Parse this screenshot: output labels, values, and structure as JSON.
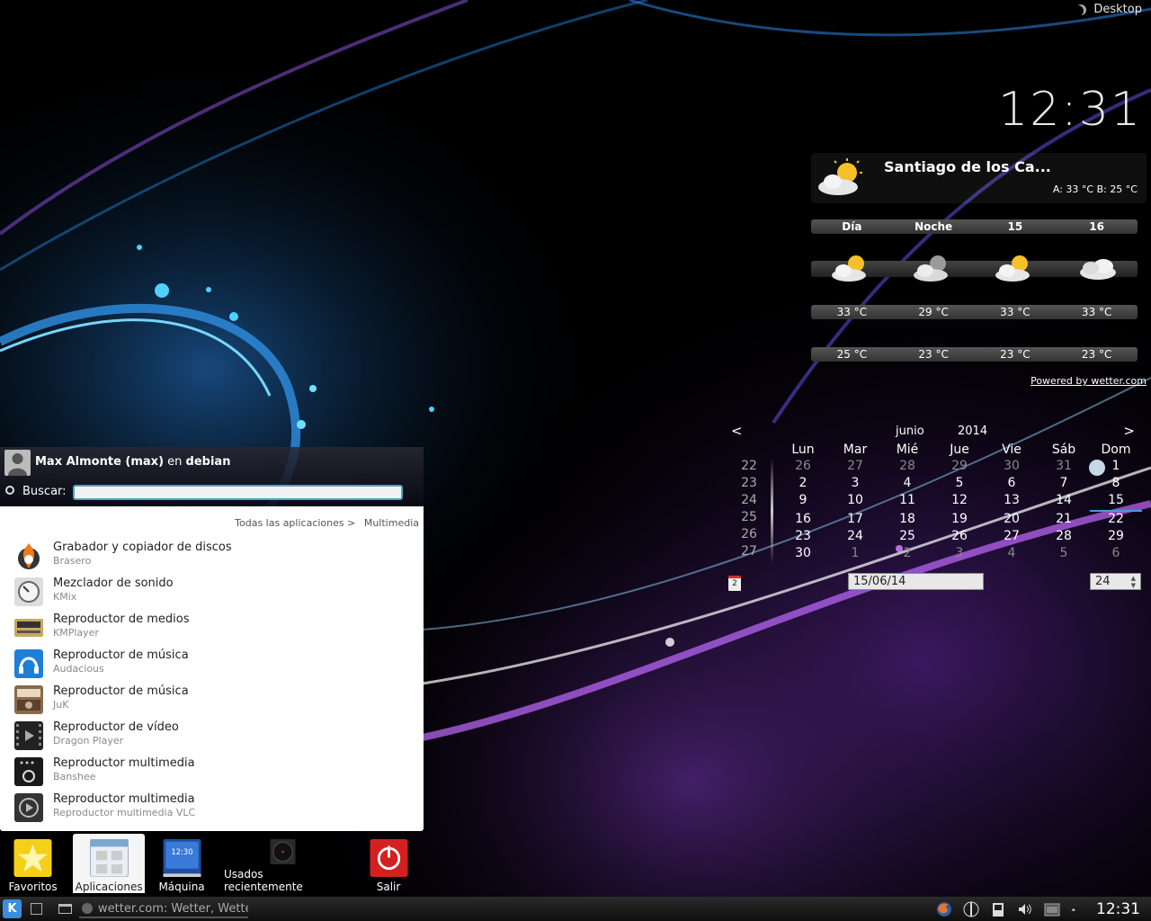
{
  "desktop": {
    "toolbox_label": "Desktop"
  },
  "clock_widget": {
    "time": "12:31"
  },
  "weather": {
    "city": "Santiago de los Ca...",
    "hilo": "A: 33 °C B: 25 °C",
    "days": [
      "Día",
      "Noche",
      "15",
      "16"
    ],
    "icons": [
      "sun-cloud-icon",
      "moon-cloud-icon",
      "sun-cloud-icon",
      "cloud-icon"
    ],
    "highs": [
      "33 °C",
      "29 °C",
      "33 °C",
      "33 °C"
    ],
    "lows": [
      "25 °C",
      "23 °C",
      "23 °C",
      "23 °C"
    ],
    "powered": "Powered by wetter.com"
  },
  "calendar": {
    "prev": "<",
    "next": ">",
    "month": "junio",
    "year": "2014",
    "weekdays": [
      "Lun",
      "Mar",
      "Mié",
      "Jue",
      "Vie",
      "Sáb",
      "Dom"
    ],
    "weeknums": [
      "22",
      "23",
      "24",
      "25",
      "26",
      "27"
    ],
    "days": [
      [
        "26",
        "27",
        "28",
        "29",
        "30",
        "31",
        "1"
      ],
      [
        "2",
        "3",
        "4",
        "5",
        "6",
        "7",
        "8"
      ],
      [
        "9",
        "10",
        "11",
        "12",
        "13",
        "14",
        "15"
      ],
      [
        "16",
        "17",
        "18",
        "19",
        "20",
        "21",
        "22"
      ],
      [
        "23",
        "24",
        "25",
        "26",
        "27",
        "28",
        "29"
      ],
      [
        "30",
        "1",
        "2",
        "3",
        "4",
        "5",
        "6"
      ]
    ],
    "date_value": "15/06/14",
    "week_value": "24",
    "icon_day": "2"
  },
  "kickoff": {
    "user_name": "Max Almonte (max)",
    "user_on": "en",
    "host": "debian",
    "search_label": "Buscar:",
    "search_value": "",
    "breadcrumb": [
      "Todas las aplicaciones >",
      "Multimedia"
    ],
    "apps": [
      {
        "name": "Grabador y copiador de discos",
        "generic": "Brasero",
        "icon": "brasero-icon"
      },
      {
        "name": "Mezclador de sonido",
        "generic": "KMix",
        "icon": "kmix-icon"
      },
      {
        "name": "Reproductor de medios",
        "generic": "KMPlayer",
        "icon": "kmplayer-icon"
      },
      {
        "name": "Reproductor de música",
        "generic": "Audacious",
        "icon": "audacious-icon"
      },
      {
        "name": "Reproductor de música",
        "generic": "JuK",
        "icon": "juk-icon"
      },
      {
        "name": "Reproductor de vídeo",
        "generic": "Dragon Player",
        "icon": "dragon-icon"
      },
      {
        "name": "Reproductor multimedia",
        "generic": "Banshee",
        "icon": "banshee-icon"
      },
      {
        "name": "Reproductor multimedia",
        "generic": "Reproductor multimedia VLC",
        "icon": "vlc-icon"
      }
    ],
    "tabs": [
      {
        "label": "Favoritos",
        "icon": "star-icon"
      },
      {
        "label": "Aplicaciones",
        "icon": "applications-icon"
      },
      {
        "label": "Máquina",
        "icon": "computer-icon",
        "icon_text": "12:30"
      },
      {
        "label": "Usados recientemente",
        "icon": "recent-icon"
      },
      {
        "label": "Salir",
        "icon": "power-icon"
      }
    ]
  },
  "taskbar": {
    "kbutton": "K",
    "task_title": "wetter.com: Wetter, Wetter",
    "clock": "12:31",
    "tray_icons": [
      "firefox-icon",
      "network-icon",
      "device-icon",
      "volume-icon",
      "battery-icon",
      "tray-expand-icon"
    ]
  }
}
